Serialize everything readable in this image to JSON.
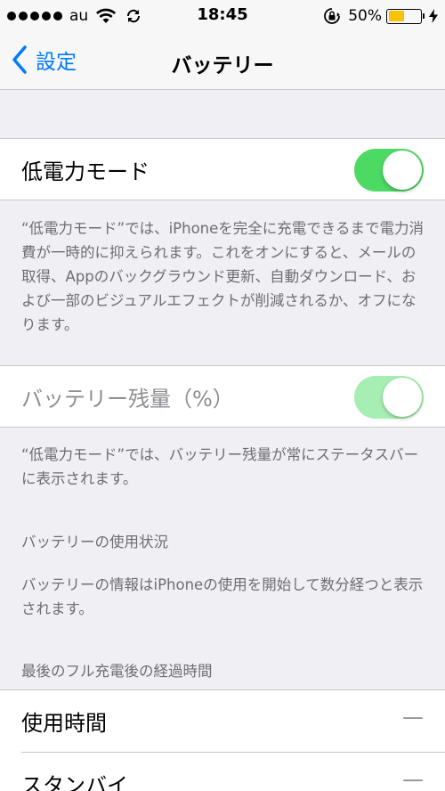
{
  "status_bar": {
    "carrier": "au",
    "time": "18:45",
    "battery_percent": "50%",
    "battery_level": 0.5,
    "battery_color": "#f8c20a",
    "icons": [
      "signal-dots-icon",
      "wifi-icon",
      "sync-icon",
      "rotation-lock-icon",
      "battery-icon",
      "charging-bolt-icon"
    ]
  },
  "nav": {
    "back_label": "設定",
    "title": "バッテリー",
    "accent_color": "#007aff"
  },
  "low_power": {
    "label": "低電力モード",
    "enabled": true,
    "footnote": "“低電力モード”では、iPhoneを完全に充電できるまで電力消費が一時的に抑えられます。これをオンにすると、メールの取得、Appのバックグラウンド更新、自動ダウンロード、および一部のビジュアルエフェクトが削減されるか、オフになります。"
  },
  "battery_percentage": {
    "label": "バッテリー残量（%）",
    "enabled": true,
    "disabled_state": true,
    "footnote": "“低電力モード”では、バッテリー残量が常にステータスバーに表示されます。"
  },
  "usage": {
    "header": "バッテリーの使用状況",
    "note": "バッテリーの情報はiPhoneの使用を開始して数分経つと表示されます。"
  },
  "since_charge": {
    "header": "最後のフル充電後の経過時間",
    "rows": [
      {
        "label": "使用時間",
        "value": "—"
      },
      {
        "label": "スタンバイ",
        "value": "—"
      }
    ]
  },
  "colors": {
    "toggle_on": "#4cd964",
    "background": "#efeff4"
  }
}
